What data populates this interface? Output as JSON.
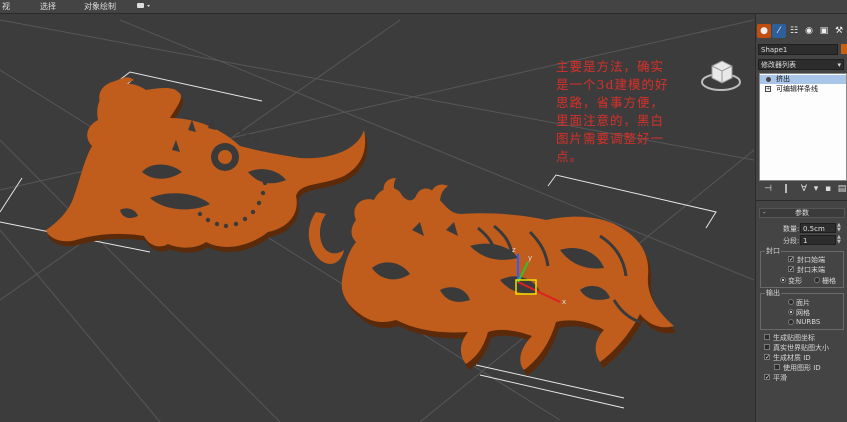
{
  "menu": {
    "items": [
      "视",
      "选择",
      "对象绘制"
    ],
    "mode_icon": "viewport-shading-icon"
  },
  "viewport": {
    "annotation": "主要是方法，确实是一个3d建模的好思路，省事方便，里面注意的，黑白图片需要调整好一点。",
    "model_color": "#c05d1c",
    "model_side_color": "#5a2a0a",
    "grid_color": "#555555",
    "selection_bracket_color": "#e6e6e6"
  },
  "command_panel": {
    "tabs": [
      "create-icon",
      "modify-icon",
      "hierarchy-icon",
      "motion-icon",
      "display-icon",
      "utilities-icon"
    ],
    "object_name": "Shape1",
    "object_color": "#c86014",
    "modifier_list_label": "修改器列表",
    "stack": [
      {
        "label": "挤出",
        "selected": true,
        "icon": "lightbulb-icon"
      },
      {
        "label": "可编辑样条线",
        "selected": false,
        "icon": "plus-box-icon"
      }
    ],
    "parameters": {
      "rollout_title": "参数",
      "amount_label": "数量:",
      "amount_value": "0.5cm",
      "segments_label": "分段:",
      "segments_value": "1",
      "cap_group_label": "封口",
      "cap_start_label": "封口始端",
      "cap_start_checked": true,
      "cap_end_label": "封口末端",
      "cap_end_checked": true,
      "morph_label": "变形",
      "grid_label": "栅格",
      "cap_type_selected": "变形",
      "output_group_label": "输出",
      "output_patch_label": "面片",
      "output_mesh_label": "网格",
      "output_nurbs_label": "NURBS",
      "output_selected": "网格",
      "gen_map_coords_label": "生成贴图坐标",
      "gen_map_coords_checked": false,
      "real_world_label": "真实世界贴图大小",
      "real_world_checked": false,
      "gen_mat_ids_label": "生成材质 ID",
      "gen_mat_ids_checked": true,
      "use_shape_ids_label": "使用图形 ID",
      "use_shape_ids_checked": false,
      "smooth_label": "平滑",
      "smooth_checked": true
    }
  }
}
